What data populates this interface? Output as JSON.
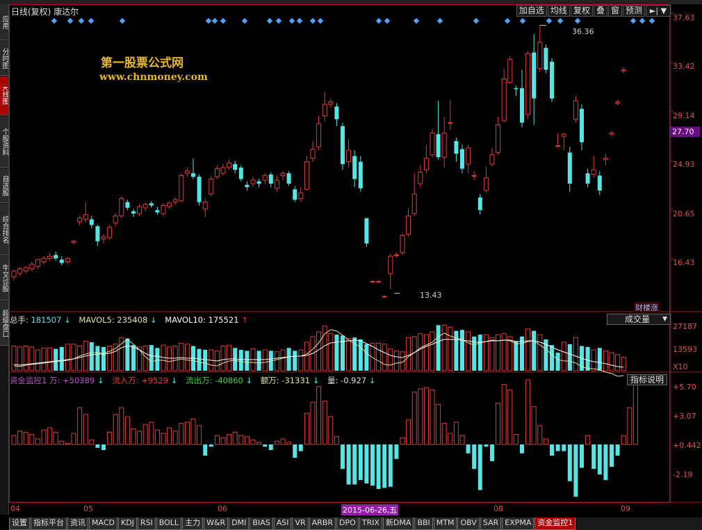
{
  "header": {
    "title": "日线(复权) 康达尔",
    "toolbar": [
      "加自选",
      "均线",
      "复权",
      "叠",
      "窗",
      "预测"
    ],
    "menu_icon": "►|",
    "menu_arrow": "▼"
  },
  "left_nav": [
    "应用",
    "分时图",
    "K线图",
    "个股资料",
    "自选股",
    "综合排名",
    "牛叉诊股",
    "超级盘口"
  ],
  "watermark": {
    "title": "第一股票公式网",
    "url": "www.chnmoney.com"
  },
  "price_axis": [
    "37.63",
    "33.42",
    "29.14",
    "24.93",
    "20.65",
    "16.43"
  ],
  "current_price": "27.70",
  "markers": {
    "high": "36.36",
    "low": "13.43"
  },
  "badge": "财楼涨",
  "volume": {
    "total_label": "总手:",
    "total": "181507",
    "ma5_label": "MAVOL5:",
    "ma5": "235408",
    "ma10_label": "MAVOL10:",
    "ma10": "175521",
    "select": "成交量",
    "axis": [
      "27187",
      "13593"
    ],
    "unit": "X10"
  },
  "fund_monitor": {
    "name": "资金监控1 万: ",
    "name_value": "+50389",
    "inflow_label": "流入万: ",
    "inflow": "+9529",
    "outflow_label": "流出万: ",
    "outflow": "-40860",
    "net_label": "额万: ",
    "net": "-31331",
    "qty_label": "量: ",
    "qty": "-0.927",
    "help_button": "指标说明",
    "axis": [
      "+5.70",
      "+3.07",
      "+0.442",
      "-2.19"
    ]
  },
  "x_axis": [
    "04",
    "05",
    "06",
    "08",
    "09"
  ],
  "cursor_date": "2015-06-26,五",
  "bottom_tabs": [
    "设置",
    "指标平台",
    "资讯",
    "MACD",
    "KDJ",
    "RSI",
    "BOLL",
    "主力",
    "W&R",
    "DMI",
    "BIAS",
    "ASI",
    "VR",
    "ARBR",
    "DPO",
    "TRIX",
    "新DMA",
    "BBI",
    "MTM",
    "OBV",
    "SAR",
    "EXPMA",
    "资金监控1"
  ],
  "colors": {
    "up": "#e03c3c",
    "down": "#54e6e6",
    "ma5": "#e8e0a0",
    "ma10": "#ffffff",
    "accent": "#9b1bb0"
  },
  "chart_data": {
    "type": "candlestick",
    "ylim": [
      11.6,
      38.2
    ],
    "candles": [
      [
        14.5,
        15.0,
        14.2,
        15.1
      ],
      [
        14.8,
        15.2,
        14.6,
        15.4
      ],
      [
        15.0,
        15.3,
        14.8,
        15.5
      ],
      [
        15.2,
        15.6,
        15.0,
        15.8
      ],
      [
        15.4,
        16.0,
        15.2,
        16.1
      ],
      [
        15.8,
        16.1,
        15.6,
        16.3
      ],
      [
        16.1,
        16.3,
        15.9,
        16.6
      ],
      [
        16.4,
        16.1,
        15.9,
        16.7
      ],
      [
        16.0,
        15.7,
        15.5,
        16.3
      ],
      [
        15.8,
        16.1,
        15.6,
        16.2
      ],
      [
        17.5,
        17.6,
        17.3,
        17.7
      ],
      [
        19.3,
        19.6,
        19.0,
        19.8
      ],
      [
        19.5,
        19.9,
        19.2,
        21.0
      ],
      [
        19.5,
        19.0,
        18.7,
        19.8
      ],
      [
        18.9,
        17.6,
        17.2,
        19.0
      ],
      [
        17.8,
        18.0,
        17.4,
        18.2
      ],
      [
        17.9,
        18.8,
        17.7,
        19.0
      ],
      [
        19.2,
        19.8,
        18.9,
        20.0
      ],
      [
        19.8,
        21.3,
        19.6,
        21.5
      ],
      [
        21.0,
        20.5,
        20.3,
        21.2
      ],
      [
        20.2,
        20.0,
        19.7,
        20.4
      ],
      [
        20.0,
        20.6,
        19.8,
        20.8
      ],
      [
        20.5,
        20.8,
        20.2,
        21.0
      ],
      [
        20.9,
        20.7,
        20.5,
        21.1
      ],
      [
        20.3,
        20.1,
        19.9,
        20.6
      ],
      [
        20.0,
        20.7,
        19.8,
        20.9
      ],
      [
        20.6,
        20.9,
        20.4,
        21.1
      ],
      [
        21.0,
        21.2,
        20.8,
        21.4
      ],
      [
        21.1,
        23.3,
        21.0,
        23.5
      ],
      [
        23.5,
        23.7,
        23.2,
        24.0
      ],
      [
        23.5,
        23.2,
        23.0,
        24.8
      ],
      [
        23.2,
        21.0,
        20.7,
        23.4
      ],
      [
        20.4,
        21.0,
        19.7,
        21.3
      ],
      [
        21.7,
        23.0,
        21.5,
        23.3
      ],
      [
        23.2,
        23.9,
        23.0,
        24.2
      ],
      [
        23.5,
        24.0,
        23.3,
        24.3
      ],
      [
        24.0,
        24.4,
        23.8,
        24.7
      ],
      [
        24.3,
        23.8,
        23.5,
        24.6
      ],
      [
        24.0,
        23.0,
        22.8,
        24.2
      ],
      [
        22.5,
        22.3,
        22.0,
        22.8
      ],
      [
        22.6,
        22.9,
        22.3,
        23.2
      ],
      [
        22.8,
        22.6,
        22.3,
        23.0
      ],
      [
        22.9,
        23.3,
        22.6,
        23.5
      ],
      [
        23.4,
        22.6,
        22.3,
        23.6
      ],
      [
        22.2,
        22.9,
        21.9,
        23.3
      ],
      [
        23.3,
        23.5,
        22.9,
        23.7
      ],
      [
        23.5,
        22.6,
        22.4,
        23.7
      ],
      [
        22.1,
        21.2,
        21.0,
        22.4
      ],
      [
        21.3,
        21.8,
        21.0,
        22.3
      ],
      [
        22.1,
        24.5,
        22.0,
        25.0
      ],
      [
        24.8,
        25.6,
        24.5,
        26.3
      ],
      [
        25.8,
        27.8,
        25.5,
        28.5
      ],
      [
        28.5,
        29.5,
        28.0,
        30.6
      ],
      [
        29.5,
        29.7,
        29.2,
        30.0
      ],
      [
        29.3,
        28.2,
        27.6,
        29.6
      ],
      [
        27.6,
        24.3,
        23.8,
        27.9
      ],
      [
        24.5,
        25.5,
        24.0,
        26.5
      ],
      [
        25.0,
        23.0,
        22.3,
        25.5
      ],
      [
        24.5,
        22.2,
        21.9,
        25.0
      ],
      [
        19.6,
        17.4,
        17.1,
        19.6
      ],
      [
        14.1,
        14.1,
        14.0,
        14.2
      ],
      [
        14.1,
        14.1,
        14.0,
        14.2
      ],
      [
        12.8,
        12.8,
        12.7,
        12.9
      ],
      [
        14.8,
        16.3,
        13.4,
        16.5
      ],
      [
        16.4,
        16.4,
        16.2,
        16.6
      ],
      [
        16.6,
        18.1,
        16.4,
        18.3
      ],
      [
        18.2,
        19.8,
        18.0,
        20.5
      ],
      [
        20.0,
        21.7,
        19.8,
        23.5
      ],
      [
        22.6,
        23.6,
        22.3,
        24.2
      ],
      [
        23.8,
        24.8,
        23.5,
        26.0
      ],
      [
        25.1,
        27.0,
        24.9,
        27.4
      ],
      [
        26.9,
        24.9,
        24.7,
        29.8
      ],
      [
        24.9,
        27.0,
        24.0,
        28.4
      ],
      [
        27.9,
        27.9,
        27.3,
        29.9
      ],
      [
        26.3,
        25.2,
        24.5,
        26.6
      ],
      [
        25.6,
        23.9,
        23.5,
        26.0
      ],
      [
        24.3,
        25.7,
        23.5,
        26.0
      ],
      [
        23.3,
        23.3,
        22.9,
        23.7
      ],
      [
        21.4,
        20.3,
        19.9,
        21.7
      ],
      [
        22.0,
        23.1,
        21.8,
        24.1
      ],
      [
        24.3,
        25.1,
        24.1,
        25.7
      ],
      [
        25.3,
        27.7,
        25.1,
        28.4
      ],
      [
        28.1,
        31.7,
        27.9,
        32.6
      ],
      [
        31.4,
        33.4,
        31.3,
        33.7
      ],
      [
        30.9,
        30.8,
        30.2,
        31.1
      ],
      [
        30.9,
        27.9,
        27.5,
        32.5
      ],
      [
        28.6,
        33.9,
        28.2,
        34.1
      ],
      [
        34.0,
        30.0,
        27.7,
        35.6
      ],
      [
        32.6,
        34.9,
        32.3,
        36.4
      ],
      [
        34.4,
        32.5,
        32.2,
        34.7
      ],
      [
        33.2,
        30.0,
        29.7,
        33.5
      ],
      [
        25.9,
        25.9,
        25.8,
        27.0
      ],
      [
        26.7,
        26.9,
        25.5,
        27.0
      ],
      [
        25.3,
        22.6,
        21.9,
        25.8
      ],
      [
        28.2,
        29.8,
        27.9,
        30.2
      ],
      [
        29.1,
        26.2,
        25.5,
        29.5
      ],
      [
        23.5,
        22.6,
        22.3,
        23.9
      ],
      [
        23.4,
        23.8,
        23.1,
        25.0
      ],
      [
        23.3,
        22.0,
        21.6,
        23.7
      ],
      [
        24.7,
        24.8,
        24.2,
        25.2
      ],
      [
        26.9,
        27.0,
        26.7,
        27.2
      ],
      [
        29.6,
        29.7,
        29.4,
        29.9
      ],
      [
        32.4,
        32.5,
        32.2,
        32.7
      ]
    ],
    "volume": [
      26,
      25,
      26,
      25,
      22,
      24,
      24,
      23,
      25,
      28,
      28,
      26,
      31,
      30,
      26,
      25,
      26,
      28,
      35,
      34,
      27,
      25,
      26,
      27,
      24,
      27,
      25,
      26,
      29,
      28,
      26,
      23,
      22,
      22,
      21,
      26,
      27,
      24,
      22,
      21,
      23,
      21,
      22,
      21,
      20,
      22,
      24,
      21,
      22,
      30,
      36,
      41,
      47,
      39,
      38,
      37,
      34,
      35,
      33,
      28,
      29,
      29,
      28,
      23,
      21,
      20,
      35,
      36,
      39,
      38,
      41,
      48,
      48,
      46,
      42,
      43,
      41,
      36,
      38,
      38,
      35,
      38,
      39,
      36,
      31,
      36,
      44,
      42,
      38,
      33,
      27,
      19,
      30,
      28,
      35,
      26,
      25,
      22,
      24,
      21,
      19,
      17,
      14
    ],
    "volume_up": [
      1,
      1,
      1,
      1,
      1,
      1,
      1,
      0,
      0,
      1,
      1,
      1,
      1,
      0,
      0,
      0,
      1,
      1,
      1,
      0,
      0,
      1,
      1,
      0,
      0,
      1,
      1,
      1,
      1,
      1,
      0,
      0,
      0,
      1,
      1,
      1,
      1,
      0,
      0,
      0,
      1,
      0,
      1,
      0,
      1,
      1,
      0,
      0,
      1,
      1,
      1,
      1,
      1,
      1,
      0,
      0,
      1,
      0,
      0,
      0,
      1,
      1,
      1,
      1,
      1,
      1,
      1,
      1,
      1,
      1,
      1,
      0,
      1,
      1,
      0,
      0,
      1,
      0,
      0,
      1,
      1,
      1,
      1,
      1,
      0,
      0,
      1,
      0,
      1,
      0,
      0,
      0,
      1,
      0,
      1,
      0,
      0,
      1,
      0,
      1,
      1,
      1,
      1
    ],
    "ma5": [
      520,
      521,
      519,
      518,
      517,
      516,
      515,
      514,
      513,
      512,
      510,
      506,
      503,
      501,
      501,
      502,
      499,
      495,
      488,
      482,
      489,
      497,
      507,
      514,
      512,
      512,
      514,
      512,
      510,
      512,
      512,
      515,
      516,
      519,
      520,
      516,
      513,
      512,
      514,
      515,
      515,
      516,
      515,
      513,
      511,
      509,
      507,
      506,
      506,
      503,
      496,
      487,
      474,
      468,
      470,
      476,
      483,
      488,
      493,
      502,
      508,
      513,
      518,
      519,
      516,
      515,
      507,
      501,
      494,
      490,
      486,
      478,
      473,
      477,
      480,
      482,
      487,
      490,
      487,
      485,
      483,
      484,
      483,
      484,
      488,
      488,
      485,
      484,
      490,
      496,
      504,
      511,
      513,
      513,
      516,
      521,
      524,
      524,
      526,
      529,
      531,
      535,
      534
    ],
    "ma10": [
      518,
      519,
      518,
      517,
      516,
      515,
      514,
      513,
      512,
      511,
      510,
      508,
      506,
      504,
      503,
      503,
      502,
      499,
      494,
      491,
      493,
      497,
      502,
      506,
      506,
      508,
      509,
      509,
      508,
      509,
      509,
      510,
      511,
      512,
      513,
      511,
      510,
      510,
      511,
      511,
      511,
      511,
      511,
      510,
      509,
      508,
      507,
      506,
      506,
      505,
      502,
      497,
      491,
      487,
      486,
      485,
      484,
      483,
      484,
      488,
      492,
      497,
      501,
      505,
      507,
      508,
      505,
      501,
      496,
      492,
      489,
      485,
      482,
      482,
      482,
      483,
      484,
      486,
      486,
      485,
      484,
      484,
      483,
      483,
      485,
      485,
      484,
      484,
      486,
      489,
      493,
      497,
      500,
      503,
      506,
      509,
      512,
      514,
      515,
      517,
      519,
      521,
      522
    ],
    "fund": [
      0.8,
      1.2,
      1.1,
      0.9,
      0.5,
      1.3,
      1.5,
      1.1,
      0.3,
      0.1,
      1.0,
      3.3,
      2.7,
      0.4,
      -0.3,
      -0.5,
      1.1,
      2.7,
      3.3,
      2.5,
      1.4,
      1.2,
      1.8,
      2.0,
      1.3,
      1.0,
      1.5,
      1.2,
      1.9,
      2.0,
      2.3,
      1.7,
      -1.0,
      -0.2,
      0.8,
      0.6,
      0.9,
      1.1,
      0.8,
      0.7,
      0.4,
      0.2,
      -0.2,
      -0.5,
      0.3,
      0.5,
      0.2,
      -1.2,
      -0.6,
      2.8,
      3.8,
      5.2,
      3.9,
      2.5,
      0.7,
      -2.2,
      -3.6,
      -3.6,
      -3.2,
      -3.5,
      -3.7,
      -4.0,
      -3.9,
      -3.8,
      -1.3,
      0.6,
      2.2,
      4.7,
      5.0,
      5.1,
      4.9,
      3.6,
      1.9,
      1.0,
      2.0,
      0.8,
      -0.8,
      -2.2,
      -4.1,
      -0.2,
      -1.5,
      3.7,
      5.4,
      4.9,
      0.9,
      -0.8,
      5.8,
      3.4,
      1.7,
      0.5,
      -1.0,
      -0.6,
      -0.6,
      -3.3,
      -4.7,
      -2.1,
      0.8,
      -2.2,
      -2.7,
      -3.2,
      -2.0,
      -1.0,
      0.8,
      3.3,
      5.7
    ]
  }
}
